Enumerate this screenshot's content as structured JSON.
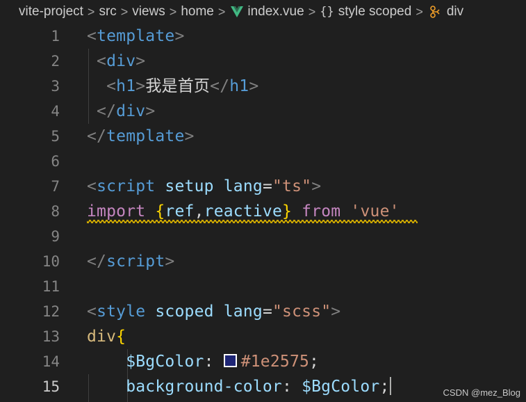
{
  "breadcrumb": {
    "items": [
      "vite-project",
      "src",
      "views",
      "home",
      "index.vue",
      "style scoped",
      "div"
    ],
    "separator": ">"
  },
  "lines": [
    {
      "n": "1",
      "tokens": [
        {
          "c": "t-br",
          "t": "<"
        },
        {
          "c": "t-tag",
          "t": "template"
        },
        {
          "c": "t-br",
          "t": ">"
        }
      ]
    },
    {
      "n": "2",
      "tokens": [
        {
          "c": "t-br",
          "t": " <"
        },
        {
          "c": "t-tag",
          "t": "div"
        },
        {
          "c": "t-br",
          "t": ">"
        }
      ]
    },
    {
      "n": "3",
      "tokens": [
        {
          "c": "t-br",
          "t": "  <"
        },
        {
          "c": "t-tag",
          "t": "h1"
        },
        {
          "c": "t-br",
          "t": ">"
        },
        {
          "c": "t-cjk",
          "t": "我是首页"
        },
        {
          "c": "t-br",
          "t": "</"
        },
        {
          "c": "t-tag",
          "t": "h1"
        },
        {
          "c": "t-br",
          "t": ">"
        }
      ]
    },
    {
      "n": "4",
      "tokens": [
        {
          "c": "t-br",
          "t": " </"
        },
        {
          "c": "t-tag",
          "t": "div"
        },
        {
          "c": "t-br",
          "t": ">"
        }
      ]
    },
    {
      "n": "5",
      "tokens": [
        {
          "c": "t-br",
          "t": "</"
        },
        {
          "c": "t-tag",
          "t": "template"
        },
        {
          "c": "t-br",
          "t": ">"
        }
      ]
    },
    {
      "n": "6",
      "tokens": []
    },
    {
      "n": "7",
      "tokens": [
        {
          "c": "t-br",
          "t": "<"
        },
        {
          "c": "t-tag",
          "t": "script"
        },
        {
          "c": "t-txt",
          "t": " "
        },
        {
          "c": "t-attr",
          "t": "setup"
        },
        {
          "c": "t-txt",
          "t": " "
        },
        {
          "c": "t-attr",
          "t": "lang"
        },
        {
          "c": "t-txt",
          "t": "="
        },
        {
          "c": "t-str",
          "t": "\"ts\""
        },
        {
          "c": "t-br",
          "t": ">"
        }
      ]
    },
    {
      "n": "8",
      "tokens": [
        {
          "c": "t-kw",
          "t": "import"
        },
        {
          "c": "t-txt",
          "t": " "
        },
        {
          "c": "t-brace",
          "t": "{"
        },
        {
          "c": "t-var",
          "t": "ref"
        },
        {
          "c": "t-txt",
          "t": ","
        },
        {
          "c": "t-var",
          "t": "reactive"
        },
        {
          "c": "t-brace",
          "t": "}"
        },
        {
          "c": "t-txt",
          "t": " "
        },
        {
          "c": "t-kw",
          "t": "from"
        },
        {
          "c": "t-txt",
          "t": " "
        },
        {
          "c": "t-str",
          "t": "'vue'"
        }
      ]
    },
    {
      "n": "9",
      "tokens": []
    },
    {
      "n": "10",
      "tokens": [
        {
          "c": "t-br",
          "t": "</"
        },
        {
          "c": "t-tag",
          "t": "script"
        },
        {
          "c": "t-br",
          "t": ">"
        }
      ]
    },
    {
      "n": "11",
      "tokens": []
    },
    {
      "n": "12",
      "tokens": [
        {
          "c": "t-br",
          "t": "<"
        },
        {
          "c": "t-tag",
          "t": "style"
        },
        {
          "c": "t-txt",
          "t": " "
        },
        {
          "c": "t-attr",
          "t": "scoped"
        },
        {
          "c": "t-txt",
          "t": " "
        },
        {
          "c": "t-attr",
          "t": "lang"
        },
        {
          "c": "t-txt",
          "t": "="
        },
        {
          "c": "t-str",
          "t": "\"scss\""
        },
        {
          "c": "t-br",
          "t": ">"
        }
      ]
    },
    {
      "n": "13",
      "tokens": [
        {
          "c": "t-sel",
          "t": "div"
        },
        {
          "c": "t-brace",
          "t": "{"
        }
      ]
    },
    {
      "n": "14",
      "tokens": [
        {
          "c": "t-txt",
          "t": "    "
        },
        {
          "c": "t-var",
          "t": "$BgColor"
        },
        {
          "c": "t-txt",
          "t": ": "
        },
        {
          "c": "swatch",
          "t": ""
        },
        {
          "c": "t-str",
          "t": "#1e2575"
        },
        {
          "c": "t-txt",
          "t": ";"
        }
      ]
    },
    {
      "n": "15",
      "tokens": [
        {
          "c": "t-txt",
          "t": "    "
        },
        {
          "c": "t-var",
          "t": "background-color"
        },
        {
          "c": "t-txt",
          "t": ": "
        },
        {
          "c": "t-var",
          "t": "$BgColor"
        },
        {
          "c": "t-txt",
          "t": ";"
        },
        {
          "c": "cursor",
          "t": ""
        }
      ]
    }
  ],
  "active_line": "15",
  "swatch_color": "#1e2575",
  "watermark": "CSDN @mez_Blog",
  "colors": {
    "background": "#1f1f1f",
    "tag": "#569cd6",
    "attribute": "#9cdcfe",
    "string": "#ce9178",
    "keyword": "#c586c0",
    "bracket": "#ffd700",
    "warning": "#cca700"
  }
}
